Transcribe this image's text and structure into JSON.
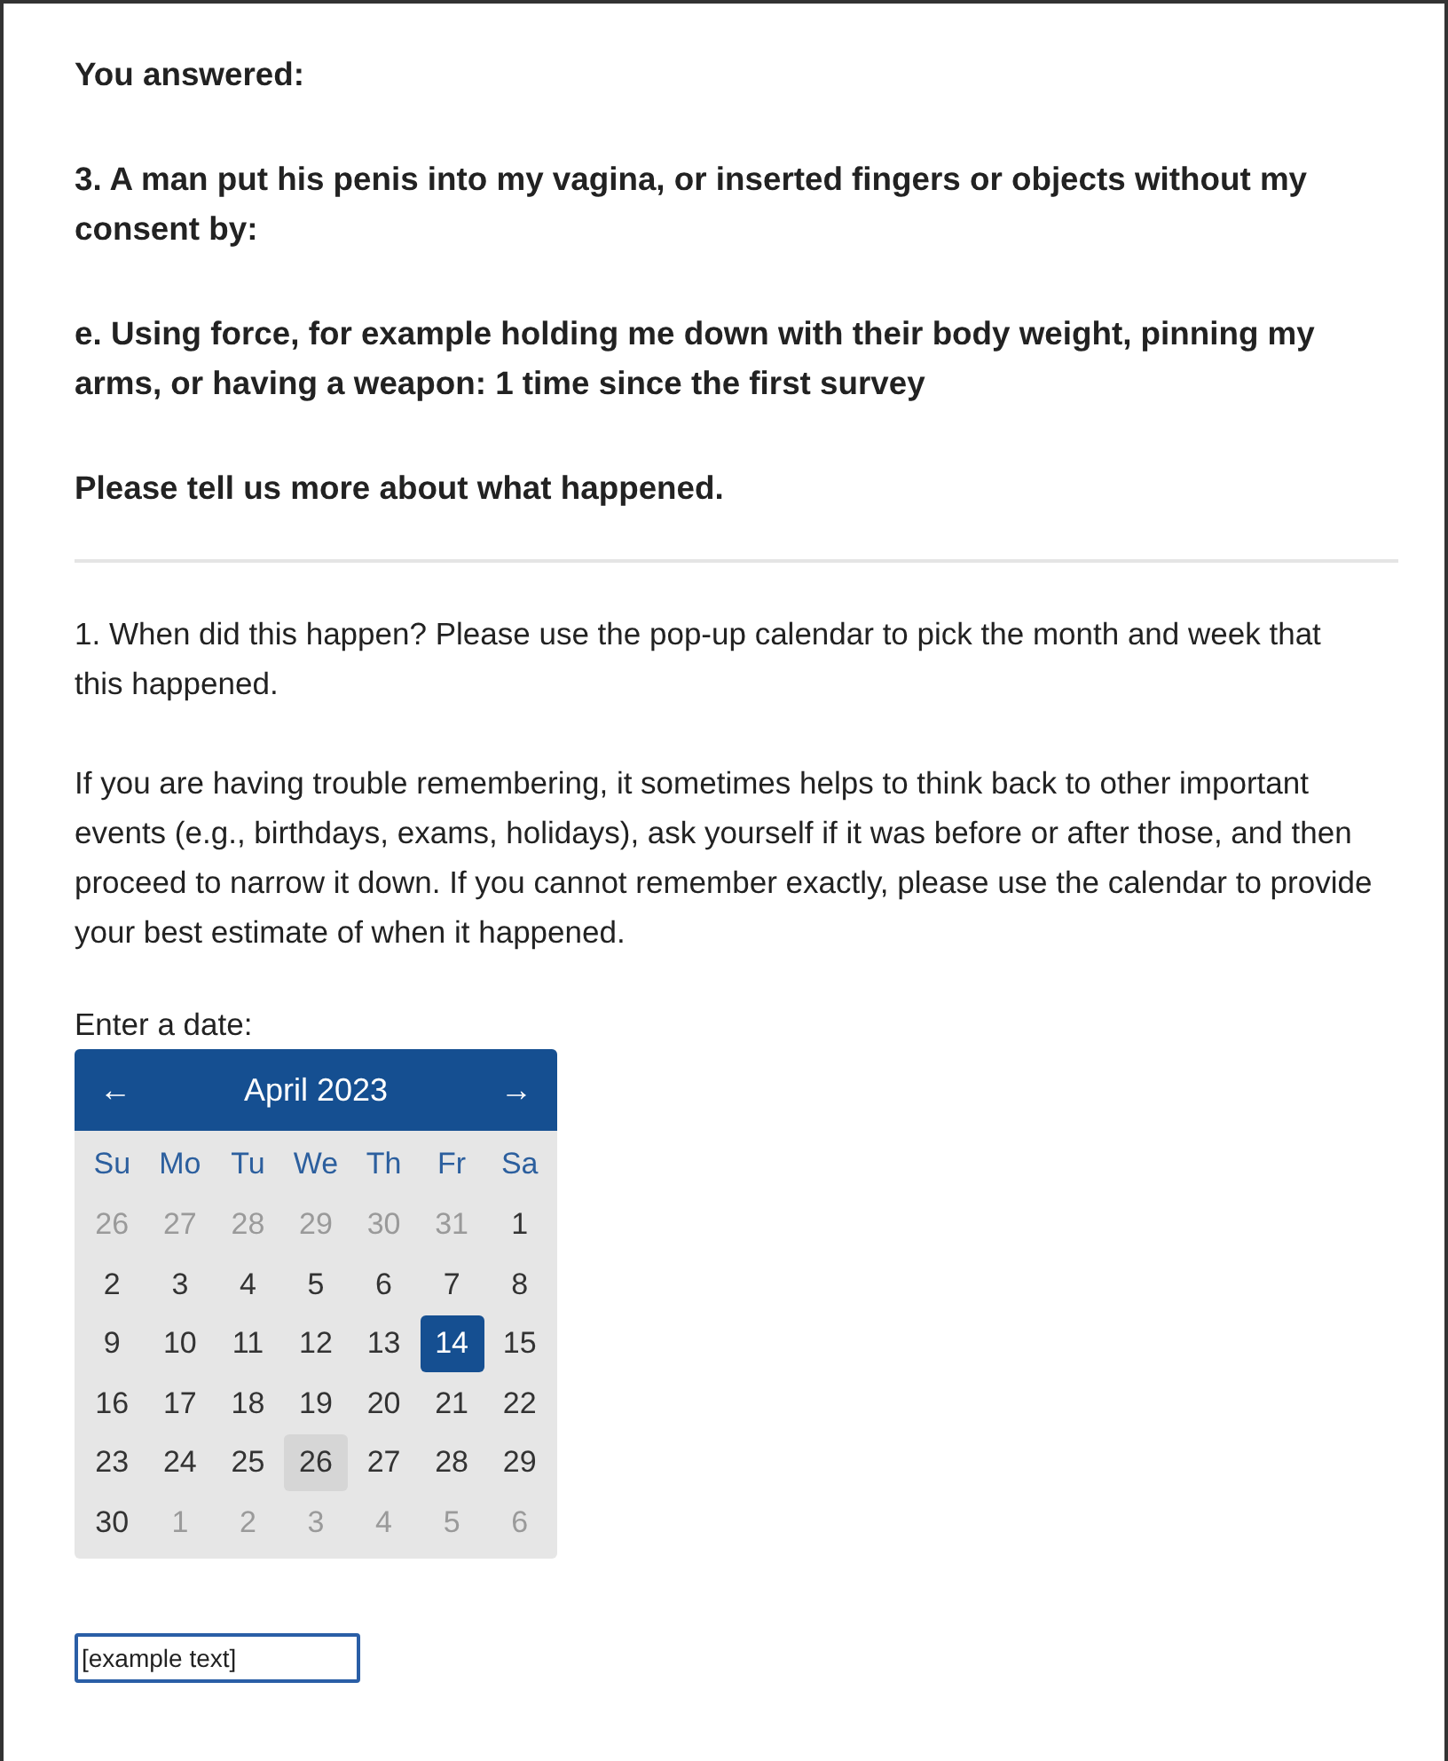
{
  "summary": [
    "You answered:",
    "3. A man put his penis into my vagina, or inserted fingers or objects without my consent by:",
    "e. Using force, for example holding me down with their body weight, pinning my arms, or having a weapon: 1 time since the first survey",
    "Please tell us more about what happened."
  ],
  "question": [
    "1. When did this happen? Please use the pop-up calendar to pick the month and week that this happened.",
    "If you are having trouble remembering, it sometimes helps to think back to other important events (e.g., birthdays, exams, holidays), ask yourself if it was before or after those, and then proceed to narrow it down. If you cannot remember exactly, please use the calendar to provide your best estimate of when it happened."
  ],
  "date_label": "Enter a date:",
  "calendar": {
    "prev": "←",
    "month": "April 2023",
    "next": "→",
    "weekdays": [
      "Su",
      "Mo",
      "Tu",
      "We",
      "Th",
      "Fr",
      "Sa"
    ],
    "weeks": [
      [
        {
          "label": "26",
          "outside": true,
          "selected": false,
          "highlighted": false
        },
        {
          "label": "27",
          "outside": true,
          "selected": false,
          "highlighted": false
        },
        {
          "label": "28",
          "outside": true,
          "selected": false,
          "highlighted": false
        },
        {
          "label": "29",
          "outside": true,
          "selected": false,
          "highlighted": false
        },
        {
          "label": "30",
          "outside": true,
          "selected": false,
          "highlighted": false
        },
        {
          "label": "31",
          "outside": true,
          "selected": false,
          "highlighted": false
        },
        {
          "label": "1",
          "outside": false,
          "selected": false,
          "highlighted": false
        }
      ],
      [
        {
          "label": "2",
          "outside": false,
          "selected": false,
          "highlighted": false
        },
        {
          "label": "3",
          "outside": false,
          "selected": false,
          "highlighted": false
        },
        {
          "label": "4",
          "outside": false,
          "selected": false,
          "highlighted": false
        },
        {
          "label": "5",
          "outside": false,
          "selected": false,
          "highlighted": false
        },
        {
          "label": "6",
          "outside": false,
          "selected": false,
          "highlighted": false
        },
        {
          "label": "7",
          "outside": false,
          "selected": false,
          "highlighted": false
        },
        {
          "label": "8",
          "outside": false,
          "selected": false,
          "highlighted": false
        }
      ],
      [
        {
          "label": "9",
          "outside": false,
          "selected": false,
          "highlighted": false
        },
        {
          "label": "10",
          "outside": false,
          "selected": false,
          "highlighted": false
        },
        {
          "label": "11",
          "outside": false,
          "selected": false,
          "highlighted": false
        },
        {
          "label": "12",
          "outside": false,
          "selected": false,
          "highlighted": false
        },
        {
          "label": "13",
          "outside": false,
          "selected": false,
          "highlighted": false
        },
        {
          "label": "14",
          "outside": false,
          "selected": true,
          "highlighted": false
        },
        {
          "label": "15",
          "outside": false,
          "selected": false,
          "highlighted": false
        }
      ],
      [
        {
          "label": "16",
          "outside": false,
          "selected": false,
          "highlighted": false
        },
        {
          "label": "17",
          "outside": false,
          "selected": false,
          "highlighted": false
        },
        {
          "label": "18",
          "outside": false,
          "selected": false,
          "highlighted": false
        },
        {
          "label": "19",
          "outside": false,
          "selected": false,
          "highlighted": false
        },
        {
          "label": "20",
          "outside": false,
          "selected": false,
          "highlighted": false
        },
        {
          "label": "21",
          "outside": false,
          "selected": false,
          "highlighted": false
        },
        {
          "label": "22",
          "outside": false,
          "selected": false,
          "highlighted": false
        }
      ],
      [
        {
          "label": "23",
          "outside": false,
          "selected": false,
          "highlighted": false
        },
        {
          "label": "24",
          "outside": false,
          "selected": false,
          "highlighted": false
        },
        {
          "label": "25",
          "outside": false,
          "selected": false,
          "highlighted": false
        },
        {
          "label": "26",
          "outside": false,
          "selected": false,
          "highlighted": true
        },
        {
          "label": "27",
          "outside": false,
          "selected": false,
          "highlighted": false
        },
        {
          "label": "28",
          "outside": false,
          "selected": false,
          "highlighted": false
        },
        {
          "label": "29",
          "outside": false,
          "selected": false,
          "highlighted": false
        }
      ],
      [
        {
          "label": "30",
          "outside": false,
          "selected": false,
          "highlighted": false
        },
        {
          "label": "1",
          "outside": true,
          "selected": false,
          "highlighted": false
        },
        {
          "label": "2",
          "outside": true,
          "selected": false,
          "highlighted": false
        },
        {
          "label": "3",
          "outside": true,
          "selected": false,
          "highlighted": false
        },
        {
          "label": "4",
          "outside": true,
          "selected": false,
          "highlighted": false
        },
        {
          "label": "5",
          "outside": true,
          "selected": false,
          "highlighted": false
        },
        {
          "label": "6",
          "outside": true,
          "selected": false,
          "highlighted": false
        }
      ]
    ]
  },
  "date_field": {
    "value": "[example text]"
  }
}
